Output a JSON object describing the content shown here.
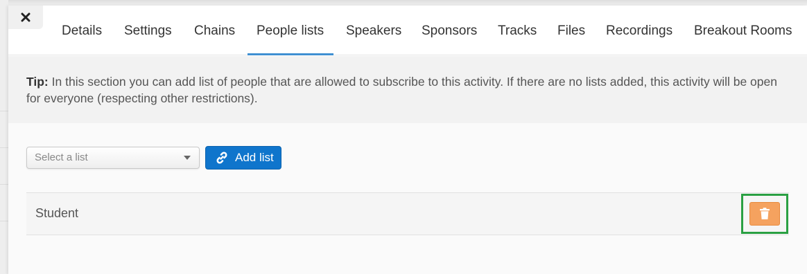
{
  "tabs": [
    {
      "label": "Details",
      "active": false
    },
    {
      "label": "Settings",
      "active": false
    },
    {
      "label": "Chains",
      "active": false
    },
    {
      "label": "People lists",
      "active": true
    },
    {
      "label": "Speakers",
      "active": false
    },
    {
      "label": "Sponsors",
      "active": false
    },
    {
      "label": "Tracks",
      "active": false
    },
    {
      "label": "Files",
      "active": false
    },
    {
      "label": "Recordings",
      "active": false
    },
    {
      "label": "Breakout Rooms",
      "active": false
    }
  ],
  "tip": {
    "prefix": "Tip:",
    "text": "In this section you can add list of people that are allowed to subscribe to this activity. If there are no lists added, this activity will be open for everyone (respecting other restrictions)."
  },
  "list_select": {
    "placeholder": "Select a list"
  },
  "add_button": {
    "label": "Add list",
    "icon": "link-icon"
  },
  "lists": [
    {
      "name": "Student",
      "action_icon": "trash-icon"
    }
  ],
  "colors": {
    "accent": "#3f8fd2",
    "primary_button": "#0f75cc",
    "delete_button": "#f5a25f",
    "highlight_box": "#2aa043"
  }
}
